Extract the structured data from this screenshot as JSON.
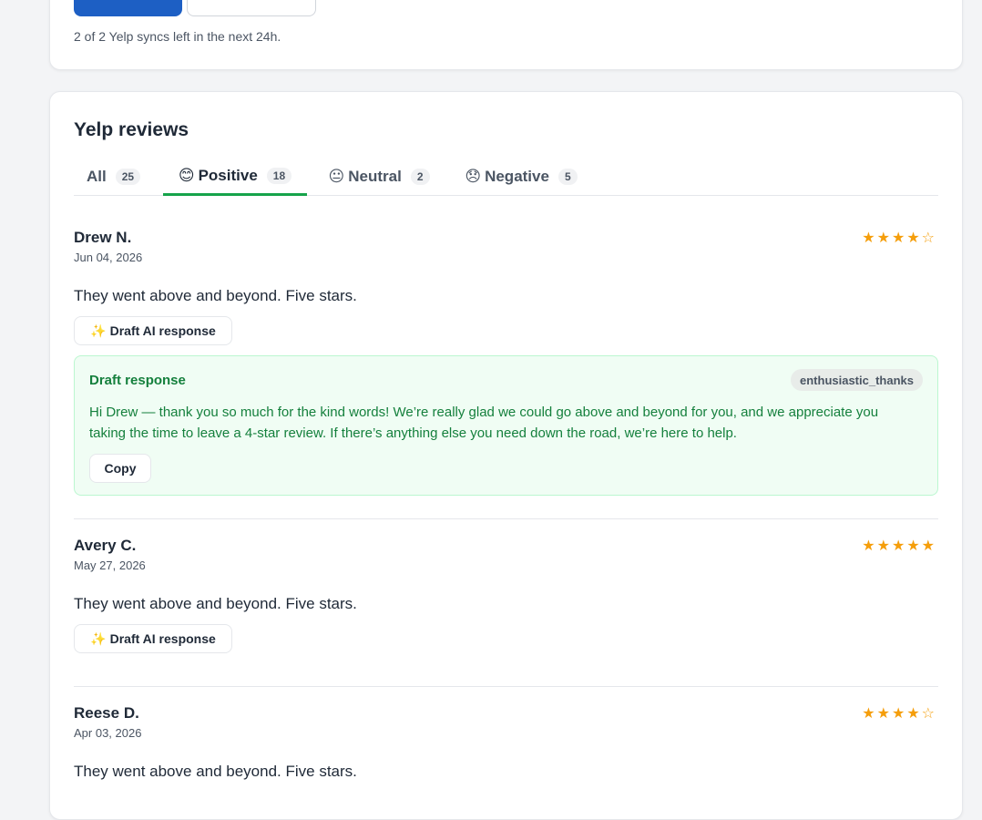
{
  "sync": {
    "note": "2 of 2 Yelp syncs left in the next 24h."
  },
  "reviews_section": {
    "title": "Yelp reviews",
    "tabs": [
      {
        "icon": "",
        "label": "All",
        "count": "25"
      },
      {
        "icon": "😊",
        "label": "Positive",
        "count": "18"
      },
      {
        "icon": "😐",
        "label": "Neutral",
        "count": "2"
      },
      {
        "icon": "😞",
        "label": "Negative",
        "count": "5"
      }
    ],
    "active_tab": "Positive",
    "reviews": [
      {
        "name": "Drew N.",
        "date": "Jun 04, 2026",
        "stars": "★★★★☆",
        "rating": 4,
        "text": "They went above and beyond. Five stars.",
        "draft_button": "Draft AI response",
        "draft": {
          "label": "Draft response",
          "tone": "enthusiastic_thanks",
          "text": "Hi Drew — thank you so much for the kind words! We’re really glad we could go above and beyond for you, and we appreciate you taking the time to leave a 4-star review. If there’s anything else you need down the road, we’re here to help.",
          "copy_label": "Copy"
        }
      },
      {
        "name": "Avery C.",
        "date": "May 27, 2026",
        "stars": "★★★★★",
        "rating": 5,
        "text": "They went above and beyond. Five stars.",
        "draft_button": "Draft AI response"
      },
      {
        "name": "Reese D.",
        "date": "Apr 03, 2026",
        "stars": "★★★★☆",
        "rating": 4,
        "text": "They went above and beyond. Five stars."
      }
    ]
  },
  "colors": {
    "accent_blue": "#1d5fc4",
    "active_tab_underline": "#16a34a",
    "star": "#f59e0b",
    "draft_green": "#15803d",
    "draft_bg": "#f0fdf4"
  }
}
